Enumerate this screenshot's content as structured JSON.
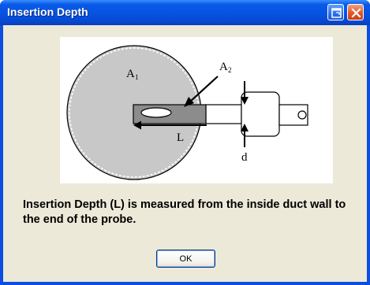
{
  "window": {
    "title": "Insertion Depth"
  },
  "title_buttons": {
    "restore_icon": "restore-icon",
    "close_icon": "close-icon"
  },
  "diagram": {
    "label_a1": "A",
    "label_a1_sub": "1",
    "label_a2": "A",
    "label_a2_sub": "2",
    "label_l": "L",
    "label_d": "d"
  },
  "message": {
    "text": "Insertion Depth (L) is measured from the inside duct wall to the end of the probe."
  },
  "buttons": {
    "ok_label": "OK"
  },
  "colors": {
    "title_bar": "#0553e0",
    "client_bg": "#ece9d8",
    "duct_fill": "#c8c8c8",
    "probe_fill": "#8c8c8c",
    "close_button": "#e2572a"
  }
}
